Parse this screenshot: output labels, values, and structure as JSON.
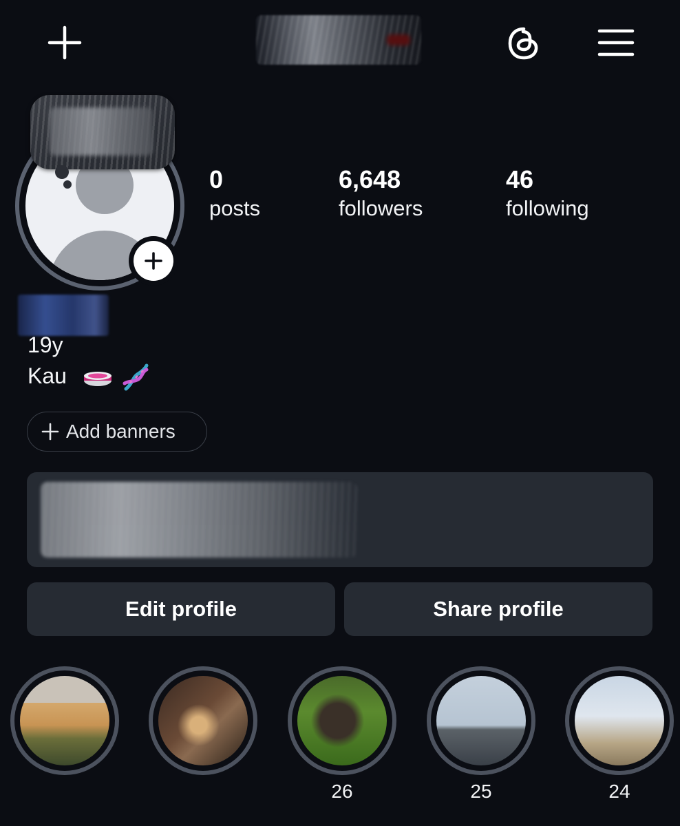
{
  "header": {
    "create_icon": "plus-icon",
    "threads_icon": "threads-icon",
    "menu_icon": "hamburger-menu-icon"
  },
  "profile": {
    "stats": [
      {
        "value": "0",
        "label": "posts"
      },
      {
        "value": "6,648",
        "label": "followers"
      },
      {
        "value": "46",
        "label": "following"
      }
    ],
    "bio_line_1": "19y",
    "bio_line_2": "Kau",
    "bio_emojis": [
      "petri-dish-icon",
      "dna-icon"
    ]
  },
  "actions": {
    "add_banners_label": "Add banners",
    "edit_profile_label": "Edit profile",
    "share_profile_label": "Share profile"
  },
  "highlights": [
    {
      "count": ""
    },
    {
      "count": ""
    },
    {
      "count": "26"
    },
    {
      "count": "25"
    },
    {
      "count": "24"
    }
  ],
  "colors": {
    "background": "#0b0d13",
    "button_bg": "#262b33",
    "ring": "#4c525e",
    "text": "#ffffff"
  }
}
